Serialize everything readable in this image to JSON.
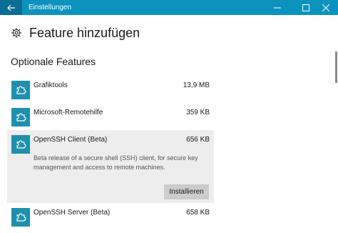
{
  "window": {
    "title": "Einstellungen",
    "icons": {
      "back": "back-arrow-icon",
      "minimize": "minimize-icon",
      "maximize": "maximize-icon",
      "close": "close-icon"
    }
  },
  "header": {
    "title": "Feature hinzufügen",
    "icon": "gear-icon"
  },
  "section": {
    "title": "Optionale Features"
  },
  "features": [
    {
      "name": "Grafiktools",
      "size": "13,9 MB",
      "icon": "puzzle-piece-icon"
    },
    {
      "name": "Microsoft-Remotehilfe",
      "size": "359 KB",
      "icon": "puzzle-piece-icon"
    },
    {
      "name": "OpenSSH Client (Beta)",
      "size": "656 KB",
      "icon": "puzzle-piece-icon",
      "description": "Beta release of a secure shell (SSH) client, for secure key management and access to remote machines.",
      "install_label": "Installieren"
    },
    {
      "name": "OpenSSH Server (Beta)",
      "size": "658 KB",
      "icon": "puzzle-piece-icon"
    }
  ],
  "colors": {
    "titlebar": "#0b93bd",
    "back_button": "#0a6e93",
    "tile": "#1f90ad",
    "selected_row": "#ededed",
    "button": "#cccccc"
  }
}
